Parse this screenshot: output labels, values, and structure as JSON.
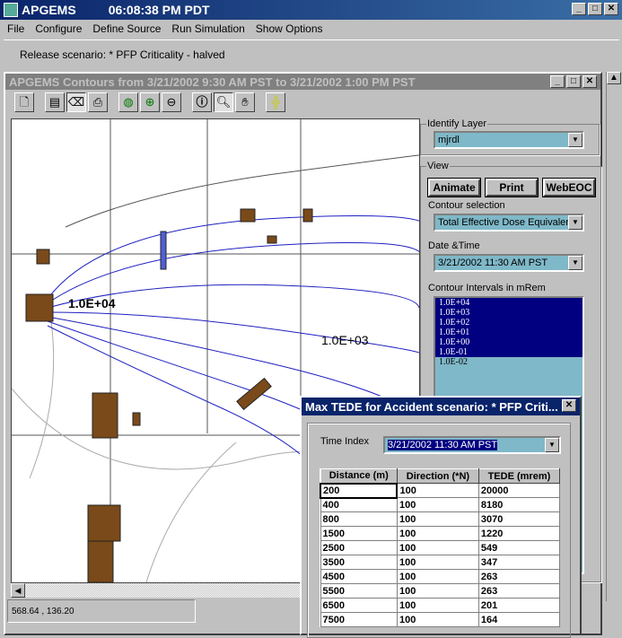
{
  "app": {
    "title": "APGEMS",
    "time": "06:08:38 PM PDT"
  },
  "menu": [
    "File",
    "Configure",
    "Define Source",
    "Run Simulation",
    "Show Options"
  ],
  "scenario": "Release scenario: * PFP Criticality - halved",
  "child": {
    "title": "APGEMS Contours from 3/21/2002 9:30 AM PST to 3/21/2002 1:00 PM PST"
  },
  "toolbar": [
    "new-icon",
    "properties-icon",
    "label-icon",
    "print-icon",
    "globe-icon",
    "zoom-in-icon",
    "zoom-out-icon",
    "info-icon",
    "zoom-icon",
    "pan-hand-icon",
    "crosshair-icon"
  ],
  "map": {
    "labels": [
      "1.0E+04",
      "1.0E+03"
    ],
    "building_color": "#7a4a1a",
    "contour_color": "#2020c0"
  },
  "status": {
    "coords": "568.64 , 136.20"
  },
  "panel": {
    "identify_layer": {
      "label": "Identify Layer",
      "value": "mjrdl"
    },
    "view": {
      "label": "View",
      "buttons": [
        "Animate",
        "Print",
        "WebEOC"
      ],
      "contour_label": "Contour selection",
      "contour_value": "Total Effective Dose Equivalent",
      "date_label": "Date &Time",
      "date_value": "3/21/2002 11:30 AM PST",
      "intervals_label": "Contour Intervals in mRem",
      "intervals": [
        {
          "v": "1.0E+04",
          "sel": true
        },
        {
          "v": "1.0E+03",
          "sel": true
        },
        {
          "v": "1.0E+02",
          "sel": true
        },
        {
          "v": "1.0E+01",
          "sel": true
        },
        {
          "v": "1.0E+00",
          "sel": true
        },
        {
          "v": "1.0E-01",
          "sel": true
        },
        {
          "v": "1.0E-02",
          "sel": false
        }
      ]
    }
  },
  "dialog": {
    "title": "Max TEDE for Accident scenario: * PFP Criti...",
    "time_label": "Time Index",
    "time_value": "3/21/2002 11:30 AM PST",
    "columns": [
      "Distance (m)",
      "Direction (*N)",
      "TEDE (mrem)"
    ],
    "rows": [
      [
        "200",
        "100",
        "20000"
      ],
      [
        "400",
        "100",
        "8180"
      ],
      [
        "800",
        "100",
        "3070"
      ],
      [
        "1500",
        "100",
        "1220"
      ],
      [
        "2500",
        "100",
        "549"
      ],
      [
        "3500",
        "100",
        "347"
      ],
      [
        "4500",
        "100",
        "263"
      ],
      [
        "5500",
        "100",
        "263"
      ],
      [
        "6500",
        "100",
        "201"
      ],
      [
        "7500",
        "100",
        "164"
      ]
    ]
  }
}
